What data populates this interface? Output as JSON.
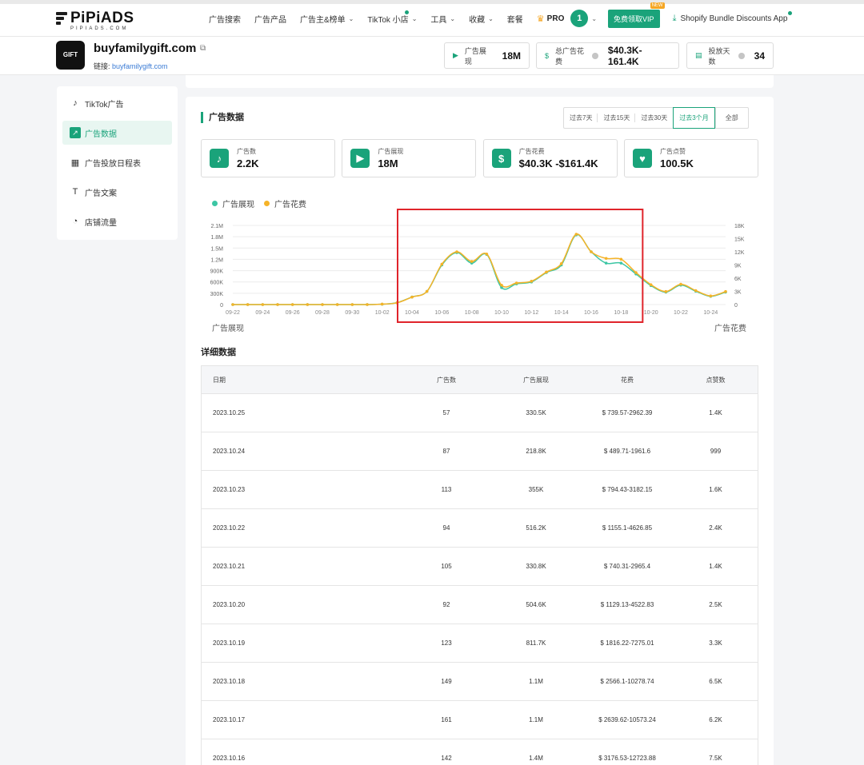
{
  "topnav": {
    "logo_text": "PiPiADS",
    "logo_sub": "PIPIADS.COM",
    "items": [
      {
        "label": "广告搜索",
        "dropdown": false,
        "dot": false
      },
      {
        "label": "广告产品",
        "dropdown": false,
        "dot": false
      },
      {
        "label": "广告主&榜单",
        "dropdown": true,
        "dot": false
      },
      {
        "label": "TikTok 小店",
        "dropdown": true,
        "dot": true
      },
      {
        "label": "工具",
        "dropdown": true,
        "dot": false
      },
      {
        "label": "收藏",
        "dropdown": true,
        "dot": false
      },
      {
        "label": "套餐",
        "dropdown": false,
        "dot": false
      }
    ],
    "pro_label": "PRO",
    "notification_count": "1",
    "vip_button": "免费领取VIP",
    "vip_badge": "NEW",
    "shopify_link": "Shopify Bundle Discounts App"
  },
  "shop": {
    "avatar_text": "GIFT",
    "name": "buyfamilygift.com",
    "link_label": "链接:",
    "link_value": "buyfamilygift.com",
    "stats": [
      {
        "icon": "play-icon",
        "label": "广告展现",
        "value": "18M",
        "help": false
      },
      {
        "icon": "dollar-icon",
        "label": "总广告花费",
        "value": "$40.3K-161.4K",
        "help": true
      },
      {
        "icon": "calendar-icon",
        "label": "投放天数",
        "value": "34",
        "help": true
      }
    ]
  },
  "sidebar": {
    "items": [
      {
        "label": "TikTok广告",
        "icon": "tiktok-icon",
        "glyph": "♪",
        "active": false
      },
      {
        "label": "广告数据",
        "icon": "trend-chart-icon",
        "glyph": "↗",
        "active": true
      },
      {
        "label": "广告投放日程表",
        "icon": "calendar-icon",
        "glyph": "▦",
        "active": false
      },
      {
        "label": "广告文案",
        "icon": "text-icon",
        "glyph": "T",
        "active": false
      },
      {
        "label": "店铺流量",
        "icon": "pie-icon",
        "glyph": "◔",
        "active": false
      }
    ]
  },
  "main": {
    "title": "广告数据",
    "ranges": [
      {
        "label": "过去7天",
        "active": false
      },
      {
        "label": "过去15天",
        "active": false
      },
      {
        "label": "过去30天",
        "active": false
      },
      {
        "label": "过去3个月",
        "active": true
      },
      {
        "label": "全部",
        "active": false
      }
    ],
    "kpis": [
      {
        "icon": "tiktok-icon",
        "glyph": "♪",
        "label": "广告数",
        "value": "2.2K"
      },
      {
        "icon": "play-icon",
        "glyph": "▶",
        "label": "广告展现",
        "value": "18M"
      },
      {
        "icon": "dollar-icon",
        "glyph": "$",
        "label": "广告花费",
        "value": "$40.3K -$161.4K"
      },
      {
        "icon": "heart-icon",
        "glyph": "♥",
        "label": "广告点赞",
        "value": "100.5K"
      }
    ],
    "detail_title": "详细数据",
    "table": {
      "headers": [
        "日期",
        "广告数",
        "广告展现",
        "花费",
        "点赞数"
      ],
      "rows": [
        [
          "2023.10.25",
          "57",
          "330.5K",
          "$ 739.57-2962.39",
          "1.4K"
        ],
        [
          "2023.10.24",
          "87",
          "218.8K",
          "$ 489.71-1961.6",
          "999"
        ],
        [
          "2023.10.23",
          "113",
          "355K",
          "$ 794.43-3182.15",
          "1.6K"
        ],
        [
          "2023.10.22",
          "94",
          "516.2K",
          "$ 1155.1-4626.85",
          "2.4K"
        ],
        [
          "2023.10.21",
          "105",
          "330.8K",
          "$ 740.31-2965.4",
          "1.4K"
        ],
        [
          "2023.10.20",
          "92",
          "504.6K",
          "$ 1129.13-4522.83",
          "2.5K"
        ],
        [
          "2023.10.19",
          "123",
          "811.7K",
          "$ 1816.22-7275.01",
          "3.3K"
        ],
        [
          "2023.10.18",
          "149",
          "1.1M",
          "$ 2566.1-10278.74",
          "6.5K"
        ],
        [
          "2023.10.17",
          "161",
          "1.1M",
          "$ 2639.62-10573.24",
          "6.2K"
        ],
        [
          "2023.10.16",
          "142",
          "1.4M",
          "$ 3176.53-12723.88",
          "7.5K"
        ]
      ]
    }
  },
  "colors": {
    "accent": "#1aa37a",
    "series_impressions": "#3cc6a4",
    "series_spend": "#f5b328",
    "highlight_box": "#e0242b"
  },
  "chart_data": {
    "type": "line",
    "legend": [
      "广告展现",
      "广告花费"
    ],
    "legend_position": "top-left",
    "x_tick_labels": [
      "09-22",
      "09-24",
      "09-26",
      "09-28",
      "09-30",
      "10-02",
      "10-04",
      "10-06",
      "10-08",
      "10-10",
      "10-12",
      "10-14",
      "10-16",
      "10-18",
      "10-20",
      "10-22",
      "10-24"
    ],
    "x": [
      "09-22",
      "09-23",
      "09-24",
      "09-25",
      "09-26",
      "09-27",
      "09-28",
      "09-29",
      "09-30",
      "10-01",
      "10-02",
      "10-03",
      "10-04",
      "10-05",
      "10-06",
      "10-07",
      "10-08",
      "10-09",
      "10-10",
      "10-11",
      "10-12",
      "10-13",
      "10-14",
      "10-15",
      "10-16",
      "10-17",
      "10-18",
      "10-19",
      "10-20",
      "10-21",
      "10-22",
      "10-23",
      "10-24",
      "10-25"
    ],
    "left_axis": {
      "name": "广告展现",
      "ticks": [
        "0",
        "300K",
        "600K",
        "900K",
        "1.2M",
        "1.5M",
        "1.8M",
        "2.1M"
      ],
      "ylim": [
        0,
        2100000
      ]
    },
    "right_axis": {
      "name": "广告花费",
      "ticks": [
        "0",
        "3K",
        "6K",
        "9K",
        "12K",
        "15K",
        "18K"
      ],
      "ylim": [
        0,
        18000
      ]
    },
    "series": [
      {
        "name": "广告展现",
        "axis": "left",
        "values": [
          0,
          0,
          0,
          0,
          0,
          0,
          0,
          0,
          0,
          0,
          10000,
          50000,
          200000,
          350000,
          1050000,
          1380000,
          1100000,
          1330000,
          450000,
          550000,
          600000,
          850000,
          1050000,
          1850000,
          1400000,
          1100000,
          1100000,
          811700,
          504600,
          330800,
          516200,
          355000,
          218800,
          330500
        ]
      },
      {
        "name": "广告花费",
        "axis": "right",
        "values": [
          0,
          0,
          0,
          0,
          0,
          0,
          0,
          0,
          0,
          0,
          100,
          400,
          1700,
          3000,
          9200,
          12000,
          9800,
          11500,
          4400,
          4900,
          5300,
          7400,
          9300,
          16000,
          12000,
          10500,
          10300,
          7275,
          4520,
          2965,
          4620,
          3180,
          1960,
          2960
        ]
      }
    ],
    "grid": true,
    "highlight_range": [
      "10-04",
      "10-18"
    ]
  }
}
